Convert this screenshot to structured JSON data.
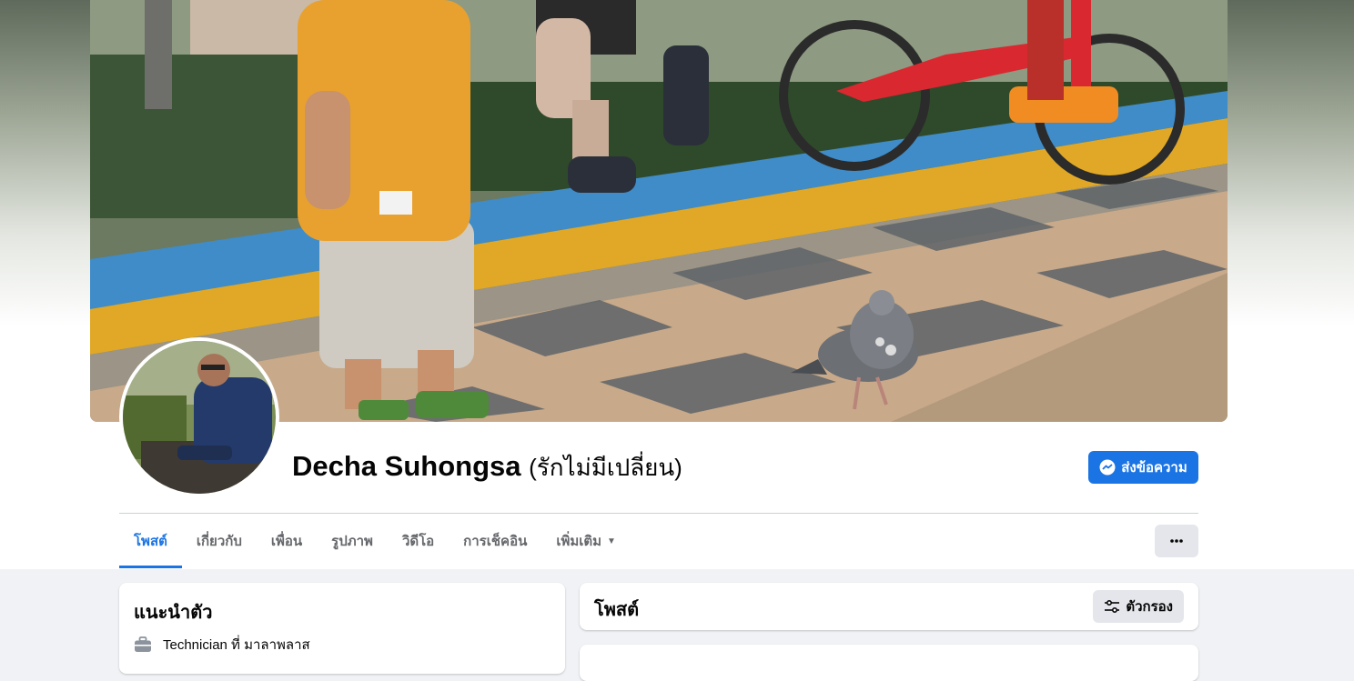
{
  "profile": {
    "name": "Decha Suhongsa",
    "alternate_name": "(รักไม่มีเปลี่ยน)"
  },
  "actions": {
    "message_label": "ส่งข้อความ",
    "message_icon": "messenger-icon",
    "more_icon": "more-horizontal-icon"
  },
  "tabs": [
    {
      "label": "โพสต์",
      "active": true
    },
    {
      "label": "เกี่ยวกับ",
      "active": false
    },
    {
      "label": "เพื่อน",
      "active": false
    },
    {
      "label": "รูปภาพ",
      "active": false
    },
    {
      "label": "วิดีโอ",
      "active": false
    },
    {
      "label": "การเช็คอิน",
      "active": false
    },
    {
      "label": "เพิ่มเติม",
      "active": false,
      "has_dropdown": true
    }
  ],
  "intro": {
    "title": "แนะนำตัว",
    "work": "Technician ที่ มาลาพลาส",
    "work_icon": "briefcase-icon"
  },
  "posts": {
    "title": "โพสต์",
    "filter_label": "ตัวกรอง",
    "filter_icon": "filter-sliders-icon"
  },
  "colors": {
    "accent": "#1b74e4",
    "page_bg": "#f0f2f5",
    "secondary_button": "#e4e6eb",
    "text_primary": "#050505",
    "text_secondary": "#65676b"
  }
}
